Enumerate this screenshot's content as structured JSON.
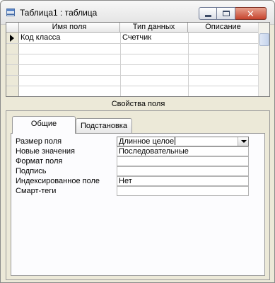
{
  "window": {
    "title": "Таблица1 : таблица",
    "close_label": "✕"
  },
  "grid": {
    "columns": [
      "Имя поля",
      "Тип данных",
      "Описание"
    ],
    "rows": [
      {
        "name": "Код класса",
        "type": "Счетчик",
        "description": ""
      }
    ]
  },
  "properties": {
    "section_title": "Свойства поля",
    "tabs": [
      "Общие",
      "Подстановка"
    ],
    "items": [
      {
        "label": "Размер поля",
        "value": "Длинное целое"
      },
      {
        "label": "Новые значения",
        "value": "Последовательные"
      },
      {
        "label": "Формат поля",
        "value": ""
      },
      {
        "label": "Подпись",
        "value": ""
      },
      {
        "label": "Индексированное поле",
        "value": "Нет"
      },
      {
        "label": "Смарт-теги",
        "value": ""
      }
    ]
  }
}
